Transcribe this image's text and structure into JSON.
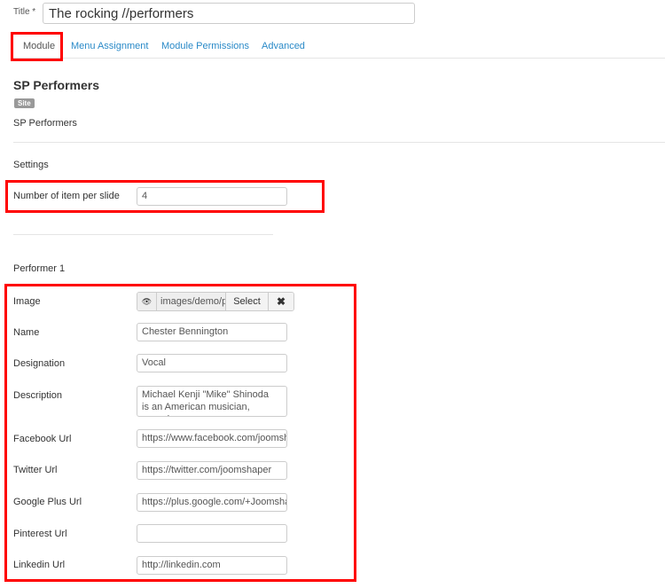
{
  "title": {
    "label": "Title *",
    "value": "The rocking //performers"
  },
  "tabs": [
    {
      "label": "Module"
    },
    {
      "label": "Menu Assignment"
    },
    {
      "label": "Module Permissions"
    },
    {
      "label": "Advanced"
    }
  ],
  "module": {
    "heading": "SP Performers",
    "badge": "Site",
    "description": "SP Performers"
  },
  "settings": {
    "heading": "Settings",
    "items_label": "Number of item per slide",
    "items_value": "4"
  },
  "performer": {
    "heading": "Performer 1",
    "image_label": "Image",
    "image_value": "images/demo/p",
    "select_label": "Select",
    "clear_label": "✖",
    "preview_icon": "👁",
    "name_label": "Name",
    "name_value": "Chester Bennington",
    "designation_label": "Designation",
    "designation_value": "Vocal",
    "description_label": "Description",
    "description_value": "Michael Kenji \"Mike\" Shinoda is an American musician, record",
    "facebook_label": "Facebook Url",
    "facebook_value": "https://www.facebook.com/joomshaper",
    "twitter_label": "Twitter Url",
    "twitter_value": "https://twitter.com/joomshaper",
    "google_label": "Google Plus Url",
    "google_value": "https://plus.google.com/+Joomshaper",
    "pinterest_label": "Pinterest Url",
    "pinterest_value": "",
    "linkedin_label": "Linkedin Url",
    "linkedin_value": "http://linkedin.com"
  }
}
